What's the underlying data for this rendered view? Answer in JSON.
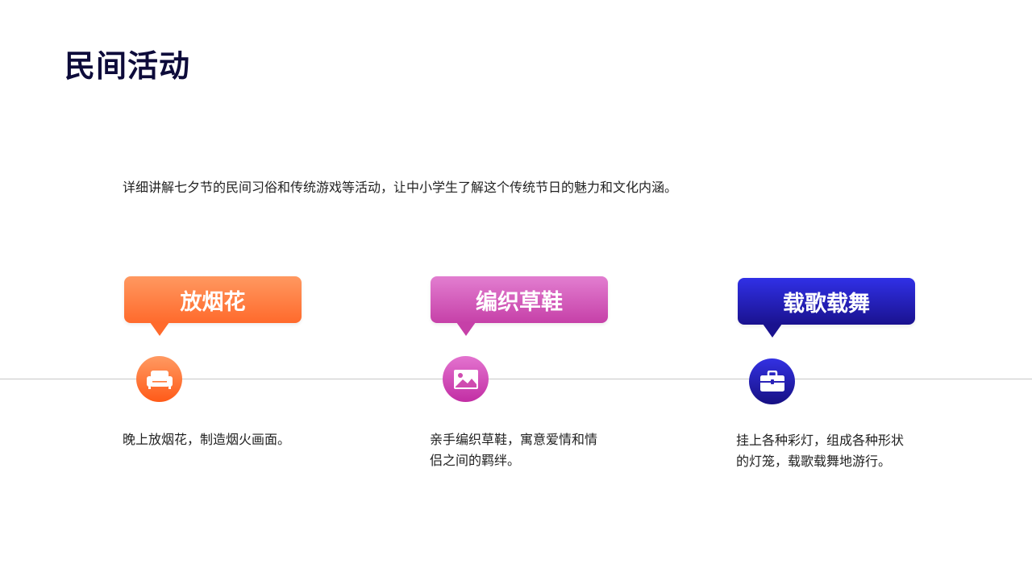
{
  "title": "民间活动",
  "subtitle": "详细讲解七夕节的民间习俗和传统游戏等活动，让中小学生了解这个传统节日的魅力和文化内涵。",
  "items": [
    {
      "label": "放烟花",
      "icon": "sofa-icon",
      "description": "晚上放烟花，制造烟火画面。",
      "color": "#ff6a2c"
    },
    {
      "label": "编织草鞋",
      "icon": "image-icon",
      "description": "亲手编织草鞋，寓意爱情和情侣之间的羁绊。",
      "color": "#c640a8"
    },
    {
      "label": "载歌载舞",
      "icon": "briefcase-icon",
      "description": "挂上各种彩灯，组成各种形状的灯笼，载歌载舞地游行。",
      "color": "#1a128f"
    }
  ]
}
